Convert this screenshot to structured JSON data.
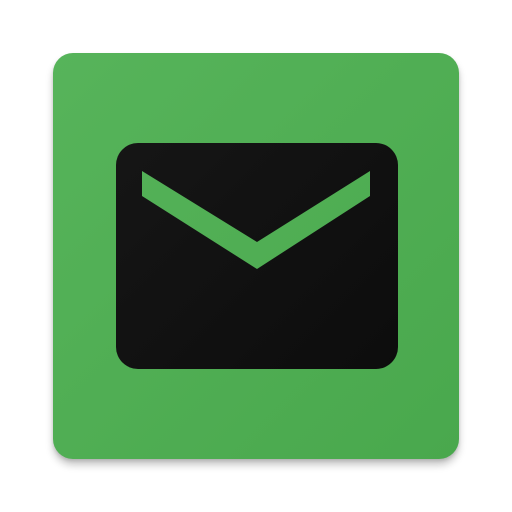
{
  "app_icon": {
    "icon": "mail-envelope-icon",
    "tile_color": "#4caf50",
    "envelope_color": "#0a0a0a",
    "flap_color": "#4caf50"
  }
}
